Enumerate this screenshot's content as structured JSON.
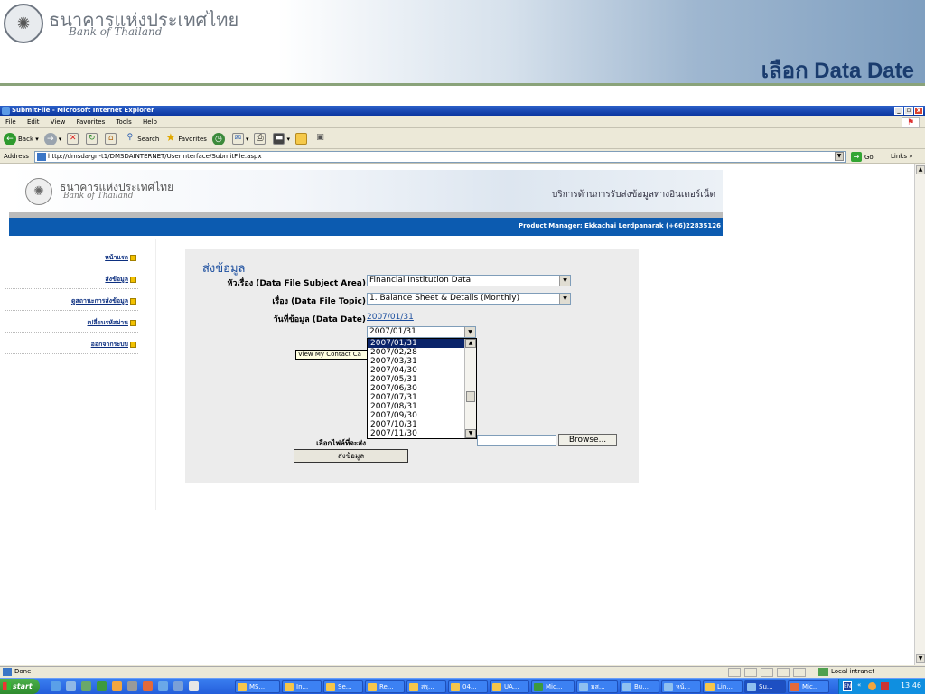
{
  "slide": {
    "logo_thai": "ธนาคารแห่งประเทศไทย",
    "logo_eng": "Bank of Thailand",
    "title": "เลือก Data Date"
  },
  "window": {
    "title": "SubmitFile - Microsoft Internet Explorer",
    "controls": [
      "_",
      "▫",
      "x"
    ],
    "menu": [
      "File",
      "Edit",
      "View",
      "Favorites",
      "Tools",
      "Help"
    ],
    "toolbar": {
      "back": "Back",
      "search": "Search",
      "favorites": "Favorites"
    },
    "address_label": "Address",
    "address": "http://dmsda-gn-t1/DMSDAINTERNET/UserInterface/SubmitFile.aspx",
    "go": "Go",
    "links": "Links »"
  },
  "page": {
    "logo_thai": "ธนาคารแห่งประเทศไทย",
    "logo_eng": "Bank of Thailand",
    "service": "บริการด้านการรับส่งข้อมูลทางอินเตอร์เน็ต",
    "manager": "Product Manager: Ekkachai Lerdpanarak (+66)22835126",
    "nav": [
      "หน้าแรก",
      "ส่งข้อมูล",
      "ดูสถานะการส่งข้อมูล",
      "เปลี่ยนรหัสผ่าน",
      "ออกจากระบบ"
    ]
  },
  "form": {
    "heading": "ส่งข้อมูล",
    "subject_label": "หัวเรื่อง (Data File Subject Area)",
    "subject_value": "Financial Institution Data",
    "topic_label": "เรื่อง (Data File Topic)",
    "topic_value": "1. Balance Sheet & Details (Monthly)",
    "date_label": "วันที่ข้อมูล (Data Date)",
    "date_link": "2007/01/31",
    "date_selected": "2007/01/31",
    "date_options": [
      "2007/01/31",
      "2007/02/28",
      "2007/03/31",
      "2007/04/30",
      "2007/05/31",
      "2007/06/30",
      "2007/07/31",
      "2007/08/31",
      "2007/09/30",
      "2007/10/31",
      "2007/11/30"
    ],
    "tooltip": "View My Contact Ca",
    "file_label": "เลือกไฟล์ที่จะส่ง",
    "browse": "Browse...",
    "submit": "ส่งข้อมูล"
  },
  "status": {
    "text": "Done",
    "zone": "Local intranet"
  },
  "taskbar": {
    "start": "start",
    "buttons": [
      "MS...",
      "In...",
      "Se...",
      "Re...",
      "สรุ...",
      "04...",
      "UA...",
      "Mic...",
      "มส...",
      "Bu...",
      "หน้...",
      "Lin...",
      "Su...",
      "Mic..."
    ],
    "lang": "EN",
    "clock": "13:46"
  }
}
